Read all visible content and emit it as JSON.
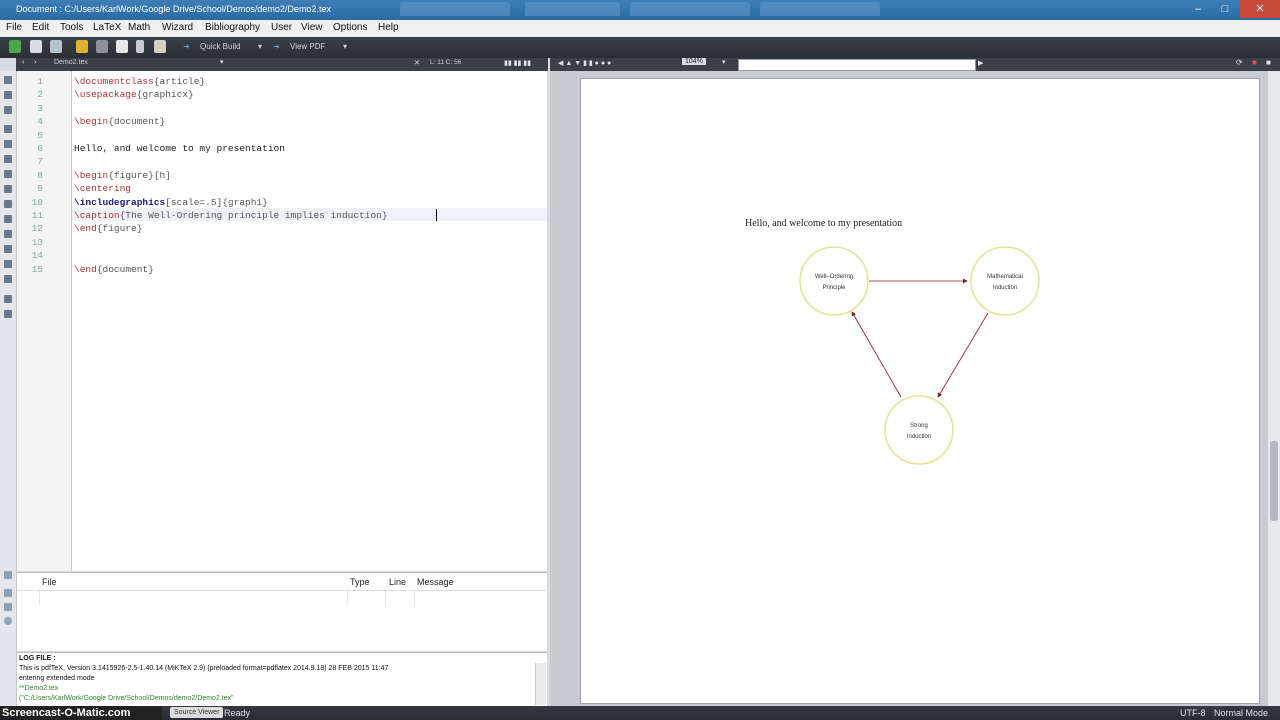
{
  "window": {
    "title": "Document : C:/Users/KarlWork/Google Drive/School/Demos/demo2/Demo2.tex"
  },
  "menu": [
    "File",
    "Edit",
    "Tools",
    "LaTeX",
    "Math",
    "Wizard",
    "Bibliography",
    "User",
    "View",
    "Options",
    "Help"
  ],
  "toolbar": {
    "quick_build": "Quick Build",
    "view_pdf": "View PDF"
  },
  "editor": {
    "tab_name": "Demo2.tex",
    "cursor_position": "L: 11 C: 56",
    "zoom": "104%",
    "lines": [
      {
        "n": "1",
        "cmd": "\\documentclass",
        "arg": "{article}"
      },
      {
        "n": "2",
        "cmd": "\\usepackage",
        "arg": "{graphicx}"
      },
      {
        "n": "3",
        "cmd": "",
        "arg": ""
      },
      {
        "n": "4",
        "cmd": "\\begin",
        "arg": "{document}"
      },
      {
        "n": "5",
        "cmd": "",
        "arg": ""
      },
      {
        "n": "6",
        "cmd": "",
        "arg": "Hello, and welcome to my presentation"
      },
      {
        "n": "7",
        "cmd": "",
        "arg": ""
      },
      {
        "n": "8",
        "cmd": "\\begin",
        "arg": "{figure}[h]"
      },
      {
        "n": "9",
        "cmd": "\\centering",
        "arg": ""
      },
      {
        "n": "10",
        "cmd": "\\includegraphics",
        "arg": "[scale=.5]{graph1}"
      },
      {
        "n": "11",
        "cmd": "\\caption",
        "arg": "{The Well-Ordering principle implies induction}"
      },
      {
        "n": "12",
        "cmd": "\\end",
        "arg": "{figure}"
      },
      {
        "n": "13",
        "cmd": "",
        "arg": ""
      },
      {
        "n": "14",
        "cmd": "",
        "arg": ""
      },
      {
        "n": "15",
        "cmd": "\\end",
        "arg": "{document}"
      }
    ]
  },
  "messages_table": {
    "headers": [
      "File",
      "Type",
      "Line",
      "Message"
    ]
  },
  "log": {
    "label": "LOG FILE :",
    "lines": [
      "This is pdfTeX, Version 3.1415926-2.5-1.40.14 (MiKTeX 2.9) (preloaded format=pdflatex 2014.9.18) 28 FEB 2015 11:47",
      "entering extended mode",
      "**Demo2.tex",
      "(\"C:/Users/KarlWork/Google Drive/School/Demos/demo2/Demo2.tex\""
    ]
  },
  "pdf": {
    "text": "Hello, and welcome to my presentation",
    "nodes": [
      {
        "line1": "Well–Ordering",
        "line2": "Principle"
      },
      {
        "line1": "Mathematical",
        "line2": "Induction"
      },
      {
        "line1": "Strong",
        "line2": "Induction"
      }
    ]
  },
  "status": {
    "watermark": "Screencast-O-Matic.com",
    "source_viewer": "Source Viewer",
    "ready": "Ready",
    "encoding": "UTF-8",
    "mode": "Normal Mode"
  }
}
